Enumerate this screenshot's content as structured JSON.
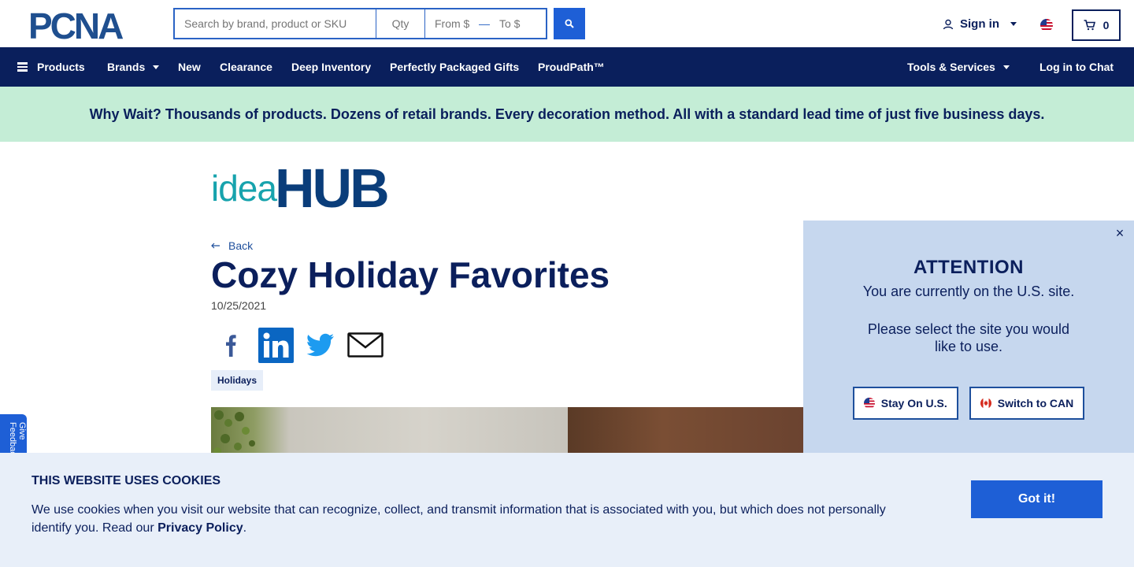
{
  "header": {
    "logo_text": "PCNA",
    "search": {
      "placeholder": "Search by brand, product or SKU",
      "value": ""
    },
    "qty": {
      "placeholder": "Qty"
    },
    "price_from": {
      "placeholder": "From $"
    },
    "price_to": {
      "placeholder": "To $"
    },
    "signin_label": "Sign in",
    "cart_count": "0"
  },
  "nav": {
    "items": [
      {
        "label": "Products"
      },
      {
        "label": "Brands"
      },
      {
        "label": "New"
      },
      {
        "label": "Clearance"
      },
      {
        "label": "Deep Inventory"
      },
      {
        "label": "Perfectly Packaged Gifts"
      },
      {
        "label": "ProudPath™"
      },
      {
        "label": "Tools & Services"
      },
      {
        "label": "Log in to Chat"
      }
    ]
  },
  "promo": {
    "text": "Why Wait? Thousands of products. Dozens of retail brands. Every decoration method. All with a standard lead time of just five business days."
  },
  "article": {
    "brand_idea": "idea",
    "brand_hub": "HUB",
    "back_label": "Back",
    "title": "Cozy Holiday Favorites",
    "date": "10/25/2021",
    "tag": "Holidays"
  },
  "feedback": {
    "label": "Give Feedback"
  },
  "attention": {
    "heading": "ATTENTION",
    "line1": "You are currently on the U.S. site.",
    "line2": "Please select the site you would like to use.",
    "stay_label": "Stay On U.S.",
    "switch_label": "Switch to CAN",
    "close_symbol": "×"
  },
  "cookie": {
    "title": "THIS WEBSITE USES COOKIES",
    "text": "We use cookies when you visit our website that can recognize, collect, and transmit information that is associated with you, but which does not personally identify you. Read our ",
    "link": "Privacy Policy",
    "end": ".",
    "button": "Got it!"
  },
  "colors": {
    "navy": "#0a1f5c",
    "brand_blue": "#1e5fd6",
    "promo_green": "#c4edd6",
    "attention_bg": "#c6d7ee",
    "cookie_bg": "#e8eff9"
  },
  "icons": [
    "search-icon",
    "user-icon",
    "us-flag-icon",
    "cart-icon",
    "menu-icon",
    "back-arrow-icon",
    "facebook-icon",
    "linkedin-icon",
    "twitter-icon",
    "email-icon",
    "canada-flag-icon",
    "close-icon"
  ]
}
